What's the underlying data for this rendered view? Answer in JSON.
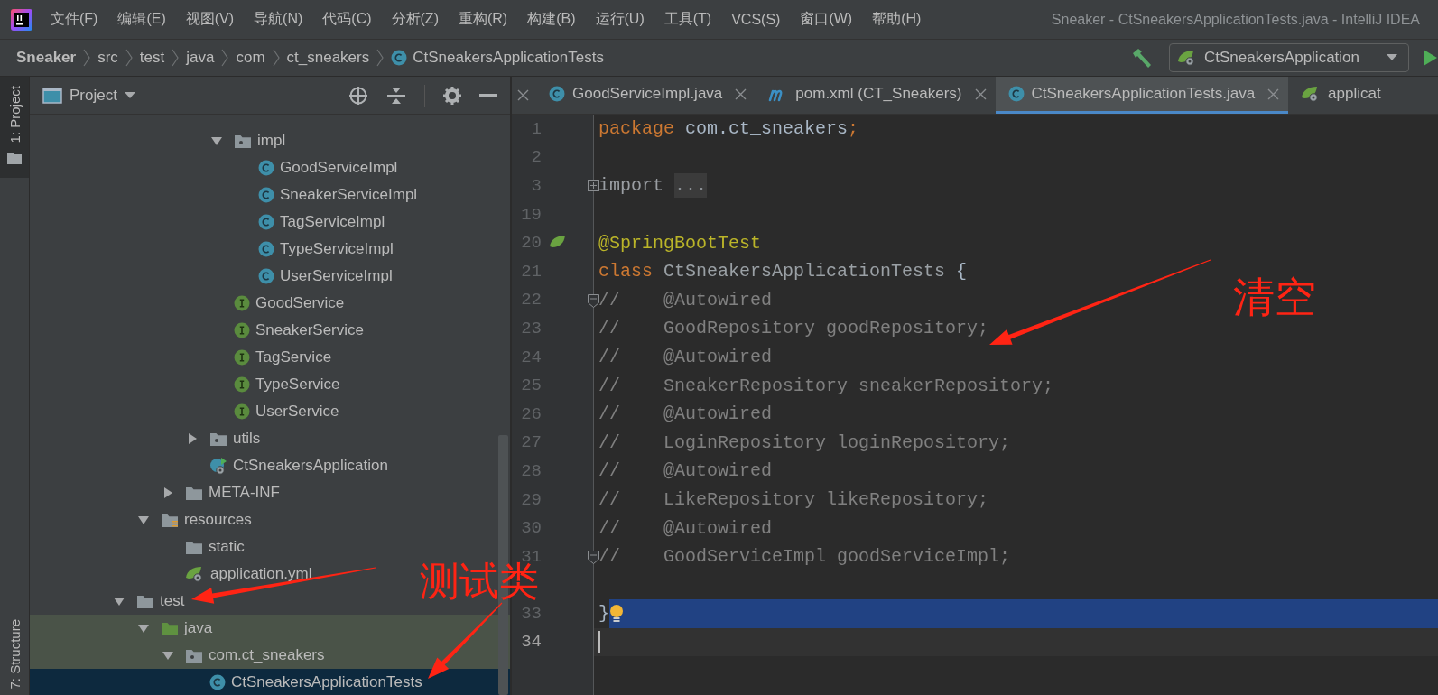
{
  "window": {
    "title": "Sneaker - CtSneakersApplicationTests.java - IntelliJ IDEA"
  },
  "menu": [
    "文件(F)",
    "编辑(E)",
    "视图(V)",
    "导航(N)",
    "代码(C)",
    "分析(Z)",
    "重构(R)",
    "构建(B)",
    "运行(U)",
    "工具(T)",
    "VCS(S)",
    "窗口(W)",
    "帮助(H)"
  ],
  "breadcrumbs": [
    {
      "label": "Sneaker",
      "kind": "project"
    },
    {
      "label": "src",
      "kind": "dir"
    },
    {
      "label": "test",
      "kind": "dir"
    },
    {
      "label": "java",
      "kind": "dir"
    },
    {
      "label": "com",
      "kind": "dir"
    },
    {
      "label": "ct_sneakers",
      "kind": "dir"
    },
    {
      "label": "CtSneakersApplicationTests",
      "kind": "class"
    }
  ],
  "run_config": {
    "label": "CtSneakersApplication"
  },
  "tool_stripes": [
    {
      "label": "1: Project",
      "selected": true,
      "kind": "top"
    },
    {
      "label": "7: Structure",
      "selected": false,
      "kind": "bottom"
    }
  ],
  "project_panel": {
    "title": "Project",
    "tree": [
      {
        "children": [
          {
            "children": [
              {
                "children": [
                  {
                    "children": [
                      {
                        "label": "impl",
                        "kind": "package",
                        "expanded": true,
                        "selected": false,
                        "highlighted": false,
                        "children": [
                          {
                            "label": "GoodServiceImpl",
                            "kind": "class",
                            "selected": false,
                            "highlighted": false
                          },
                          {
                            "label": "SneakerServiceImpl",
                            "kind": "class",
                            "selected": false,
                            "highlighted": false
                          },
                          {
                            "label": "TagServiceImpl",
                            "kind": "class",
                            "selected": false,
                            "highlighted": false
                          },
                          {
                            "label": "TypeServiceImpl",
                            "kind": "class",
                            "selected": false,
                            "highlighted": false
                          },
                          {
                            "label": "UserServiceImpl",
                            "kind": "class",
                            "selected": false,
                            "highlighted": false
                          }
                        ]
                      },
                      {
                        "label": "GoodService",
                        "kind": "interface",
                        "selected": false,
                        "highlighted": false
                      },
                      {
                        "label": "SneakerService",
                        "kind": "interface",
                        "selected": false,
                        "highlighted": false
                      },
                      {
                        "label": "TagService",
                        "kind": "interface",
                        "selected": false,
                        "highlighted": false
                      },
                      {
                        "label": "TypeService",
                        "kind": "interface",
                        "selected": false,
                        "highlighted": false
                      },
                      {
                        "label": "UserService",
                        "kind": "interface",
                        "selected": false,
                        "highlighted": false
                      }
                    ]
                  },
                  {
                    "label": "utils",
                    "kind": "package",
                    "expanded": false,
                    "selected": false,
                    "highlighted": false
                  },
                  {
                    "label": "CtSneakersApplication",
                    "kind": "springapp",
                    "selected": false,
                    "highlighted": false
                  }
                ]
              },
              {
                "label": "META-INF",
                "kind": "folder",
                "expanded": false,
                "selected": false,
                "highlighted": false
              }
            ]
          },
          {
            "label": "resources",
            "kind": "resources",
            "expanded": true,
            "selected": false,
            "highlighted": false,
            "children": [
              {
                "label": "static",
                "kind": "folder",
                "selected": false,
                "highlighted": false
              },
              {
                "label": "application.yml",
                "kind": "config",
                "selected": false,
                "highlighted": false
              }
            ]
          }
        ]
      },
      {
        "label": "test",
        "kind": "folder",
        "expanded": true,
        "selected": false,
        "highlighted": false,
        "children": [
          {
            "label": "java",
            "kind": "sources",
            "expanded": true,
            "selected": false,
            "highlighted": true,
            "children": [
              {
                "label": "com.ct_sneakers",
                "kind": "package",
                "expanded": true,
                "selected": false,
                "highlighted": true,
                "children": [
                  {
                    "label": "CtSneakersApplicationTests",
                    "kind": "class",
                    "selected": true
                  }
                ]
              }
            ]
          }
        ]
      }
    ]
  },
  "editor": {
    "tabs": [
      {
        "label": "GoodServiceImpl.java",
        "kind": "class",
        "selected": false,
        "closable": true
      },
      {
        "label": "pom.xml (CT_Sneakers)",
        "kind": "maven",
        "selected": false,
        "closable": true
      },
      {
        "label": "CtSneakersApplicationTests.java",
        "kind": "class",
        "selected": true,
        "closable": true
      },
      {
        "label": "applicat",
        "kind": "config",
        "selected": false,
        "closable": false
      }
    ],
    "lines": [
      {
        "number": "1",
        "kind": "plain",
        "tokens": [
          {
            "text": "package",
            "kind": "keyword"
          },
          {
            "text": " com.ct_sneakers",
            "kind": "plain"
          },
          {
            "text": ";",
            "kind": "keyword"
          }
        ],
        "selected": false,
        "caret": false
      },
      {
        "number": "2",
        "kind": "plain",
        "selected": false,
        "caret": false
      },
      {
        "number": "3",
        "kind": "collapsed",
        "tokens": [
          {
            "text": "import ",
            "kind": "muted"
          },
          {
            "text": "...",
            "kind": "folded"
          }
        ],
        "selected": false,
        "caret": false
      },
      {
        "number": "19",
        "kind": "plain",
        "selected": false,
        "caret": false
      },
      {
        "number": "20",
        "kind": "bean",
        "tokens": [
          {
            "text": "@SpringBootTest",
            "kind": "annotation"
          }
        ],
        "selected": false,
        "caret": false
      },
      {
        "number": "21",
        "kind": "plain",
        "tokens": [
          {
            "text": "class",
            "kind": "keyword"
          },
          {
            "text": " CtSneakersApplicationTests",
            "kind": "unused"
          },
          {
            "text": " {",
            "kind": "plain"
          }
        ],
        "selected": false,
        "caret": false
      },
      {
        "number": "22",
        "kind": "fold",
        "tokens": [
          {
            "text": "//    @Autowired",
            "kind": "comment"
          }
        ],
        "selected": false,
        "caret": false
      },
      {
        "number": "23",
        "kind": "plain",
        "tokens": [
          {
            "text": "//    GoodRepository goodRepository;",
            "kind": "comment"
          }
        ],
        "selected": false,
        "caret": false
      },
      {
        "number": "24",
        "kind": "plain",
        "tokens": [
          {
            "text": "//    @Autowired",
            "kind": "comment"
          }
        ],
        "selected": false,
        "caret": false
      },
      {
        "number": "25",
        "kind": "plain",
        "tokens": [
          {
            "text": "//    SneakerRepository sneakerRepository;",
            "kind": "comment"
          }
        ],
        "selected": false,
        "caret": false
      },
      {
        "number": "26",
        "kind": "plain",
        "tokens": [
          {
            "text": "//    @Autowired",
            "kind": "comment"
          }
        ],
        "selected": false,
        "caret": false
      },
      {
        "number": "27",
        "kind": "plain",
        "tokens": [
          {
            "text": "//    LoginRepository loginRepository;",
            "kind": "comment"
          }
        ],
        "selected": false,
        "caret": false
      },
      {
        "number": "28",
        "kind": "plain",
        "tokens": [
          {
            "text": "//    @Autowired",
            "kind": "comment"
          }
        ],
        "selected": false,
        "caret": false
      },
      {
        "number": "29",
        "kind": "plain",
        "tokens": [
          {
            "text": "//    LikeRepository likeRepository;",
            "kind": "comment"
          }
        ],
        "selected": false,
        "caret": false
      },
      {
        "number": "30",
        "kind": "plain",
        "tokens": [
          {
            "text": "//    @Autowired",
            "kind": "comment"
          }
        ],
        "selected": false,
        "caret": false
      },
      {
        "number": "31",
        "kind": "fold",
        "tokens": [
          {
            "text": "//    GoodServiceImpl goodServiceImpl;",
            "kind": "comment"
          }
        ],
        "selected": false,
        "caret": false
      },
      {
        "kind": "plain",
        "selected": false,
        "caret": false
      },
      {
        "number": "33",
        "kind": "bulb",
        "tokens": [
          {
            "text": "}",
            "kind": "plain"
          }
        ],
        "selected": true,
        "caret": false
      },
      {
        "number": "34",
        "kind": "plain",
        "selected": false,
        "caret": true
      }
    ]
  },
  "annotations": [
    {
      "text": "清空",
      "kind": "editor"
    },
    {
      "text": "测试类",
      "kind": "tree"
    }
  ]
}
